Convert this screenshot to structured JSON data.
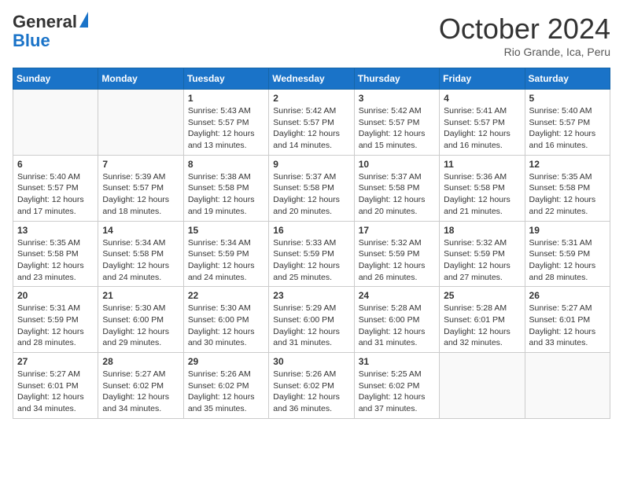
{
  "header": {
    "logo_line1": "General",
    "logo_line2": "Blue",
    "month_title": "October 2024",
    "subtitle": "Rio Grande, Ica, Peru"
  },
  "weekdays": [
    "Sunday",
    "Monday",
    "Tuesday",
    "Wednesday",
    "Thursday",
    "Friday",
    "Saturday"
  ],
  "weeks": [
    [
      {
        "day": "",
        "info": ""
      },
      {
        "day": "",
        "info": ""
      },
      {
        "day": "1",
        "info": "Sunrise: 5:43 AM\nSunset: 5:57 PM\nDaylight: 12 hours and 13 minutes."
      },
      {
        "day": "2",
        "info": "Sunrise: 5:42 AM\nSunset: 5:57 PM\nDaylight: 12 hours and 14 minutes."
      },
      {
        "day": "3",
        "info": "Sunrise: 5:42 AM\nSunset: 5:57 PM\nDaylight: 12 hours and 15 minutes."
      },
      {
        "day": "4",
        "info": "Sunrise: 5:41 AM\nSunset: 5:57 PM\nDaylight: 12 hours and 16 minutes."
      },
      {
        "day": "5",
        "info": "Sunrise: 5:40 AM\nSunset: 5:57 PM\nDaylight: 12 hours and 16 minutes."
      }
    ],
    [
      {
        "day": "6",
        "info": "Sunrise: 5:40 AM\nSunset: 5:57 PM\nDaylight: 12 hours and 17 minutes."
      },
      {
        "day": "7",
        "info": "Sunrise: 5:39 AM\nSunset: 5:57 PM\nDaylight: 12 hours and 18 minutes."
      },
      {
        "day": "8",
        "info": "Sunrise: 5:38 AM\nSunset: 5:58 PM\nDaylight: 12 hours and 19 minutes."
      },
      {
        "day": "9",
        "info": "Sunrise: 5:37 AM\nSunset: 5:58 PM\nDaylight: 12 hours and 20 minutes."
      },
      {
        "day": "10",
        "info": "Sunrise: 5:37 AM\nSunset: 5:58 PM\nDaylight: 12 hours and 20 minutes."
      },
      {
        "day": "11",
        "info": "Sunrise: 5:36 AM\nSunset: 5:58 PM\nDaylight: 12 hours and 21 minutes."
      },
      {
        "day": "12",
        "info": "Sunrise: 5:35 AM\nSunset: 5:58 PM\nDaylight: 12 hours and 22 minutes."
      }
    ],
    [
      {
        "day": "13",
        "info": "Sunrise: 5:35 AM\nSunset: 5:58 PM\nDaylight: 12 hours and 23 minutes."
      },
      {
        "day": "14",
        "info": "Sunrise: 5:34 AM\nSunset: 5:58 PM\nDaylight: 12 hours and 24 minutes."
      },
      {
        "day": "15",
        "info": "Sunrise: 5:34 AM\nSunset: 5:59 PM\nDaylight: 12 hours and 24 minutes."
      },
      {
        "day": "16",
        "info": "Sunrise: 5:33 AM\nSunset: 5:59 PM\nDaylight: 12 hours and 25 minutes."
      },
      {
        "day": "17",
        "info": "Sunrise: 5:32 AM\nSunset: 5:59 PM\nDaylight: 12 hours and 26 minutes."
      },
      {
        "day": "18",
        "info": "Sunrise: 5:32 AM\nSunset: 5:59 PM\nDaylight: 12 hours and 27 minutes."
      },
      {
        "day": "19",
        "info": "Sunrise: 5:31 AM\nSunset: 5:59 PM\nDaylight: 12 hours and 28 minutes."
      }
    ],
    [
      {
        "day": "20",
        "info": "Sunrise: 5:31 AM\nSunset: 5:59 PM\nDaylight: 12 hours and 28 minutes."
      },
      {
        "day": "21",
        "info": "Sunrise: 5:30 AM\nSunset: 6:00 PM\nDaylight: 12 hours and 29 minutes."
      },
      {
        "day": "22",
        "info": "Sunrise: 5:30 AM\nSunset: 6:00 PM\nDaylight: 12 hours and 30 minutes."
      },
      {
        "day": "23",
        "info": "Sunrise: 5:29 AM\nSunset: 6:00 PM\nDaylight: 12 hours and 31 minutes."
      },
      {
        "day": "24",
        "info": "Sunrise: 5:28 AM\nSunset: 6:00 PM\nDaylight: 12 hours and 31 minutes."
      },
      {
        "day": "25",
        "info": "Sunrise: 5:28 AM\nSunset: 6:01 PM\nDaylight: 12 hours and 32 minutes."
      },
      {
        "day": "26",
        "info": "Sunrise: 5:27 AM\nSunset: 6:01 PM\nDaylight: 12 hours and 33 minutes."
      }
    ],
    [
      {
        "day": "27",
        "info": "Sunrise: 5:27 AM\nSunset: 6:01 PM\nDaylight: 12 hours and 34 minutes."
      },
      {
        "day": "28",
        "info": "Sunrise: 5:27 AM\nSunset: 6:02 PM\nDaylight: 12 hours and 34 minutes."
      },
      {
        "day": "29",
        "info": "Sunrise: 5:26 AM\nSunset: 6:02 PM\nDaylight: 12 hours and 35 minutes."
      },
      {
        "day": "30",
        "info": "Sunrise: 5:26 AM\nSunset: 6:02 PM\nDaylight: 12 hours and 36 minutes."
      },
      {
        "day": "31",
        "info": "Sunrise: 5:25 AM\nSunset: 6:02 PM\nDaylight: 12 hours and 37 minutes."
      },
      {
        "day": "",
        "info": ""
      },
      {
        "day": "",
        "info": ""
      }
    ]
  ]
}
